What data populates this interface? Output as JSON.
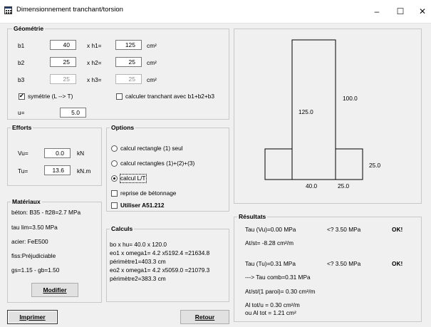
{
  "window": {
    "title": "Dimensionnement tranchant/torsion",
    "controls": [
      "–",
      "☐",
      "✕"
    ]
  },
  "geometrie": {
    "legend": "Géométrie",
    "b1_label": "b1",
    "b1_value": "40",
    "xh1_label": "x h1=",
    "h1_value": "125",
    "unit_h1": "cm²",
    "b2_label": "b2",
    "b2_value": "25",
    "xh2_label": "x h2=",
    "h2_value": "25",
    "unit_h2": "cm²",
    "b3_label": "b3",
    "b3_value": "25",
    "xh3_label": "x h3=",
    "h3_value": "25",
    "unit_h3": "cm²",
    "symetrie_label": "symétrie (L --> T)",
    "symetrie_checked": true,
    "calc_tranchant_label": "calculer tranchant avec b1+b2+b3",
    "calc_tranchant_checked": false,
    "u_label": "u=",
    "u_value": "5.0"
  },
  "efforts": {
    "legend": "Efforts",
    "vu_label": "Vu=",
    "vu_value": "0.0",
    "vu_unit": "kN",
    "tu_label": "Tu=",
    "tu_value": "13.6",
    "tu_unit": "kN.m"
  },
  "options": {
    "legend": "Options",
    "radios": [
      {
        "label": "calcul rectangle (1) seul",
        "checked": false
      },
      {
        "label": "calcul rectangles (1)+(2)+(3)",
        "checked": false
      },
      {
        "label": "calcul L/T",
        "checked": true
      }
    ],
    "reprise_label": "reprise de bétonnage",
    "reprise_checked": false,
    "a51_label": "Utiliser A51.212",
    "a51_checked": false
  },
  "materiaux": {
    "legend": "Matériaux",
    "lines": [
      "béton: B35 - ft28=2.7  MPa",
      "tau lim=3.50 MPa",
      "acier: FeE500",
      "fiss:Préjudiciable",
      "gs=1.15 - gb=1.50"
    ],
    "modifier_label": "Modifier"
  },
  "calculs": {
    "legend": "Calculs",
    "lines": [
      "bo x hu= 40.0 x 120.0",
      "eo1 x omega1= 4.2 x5192.4 =21634.8",
      "périmètre1=403.3 cm",
      "eo2 x omega1= 4.2 x5059.0 =21079.3",
      "périmètre2=383.3 cm"
    ]
  },
  "diagram": {
    "label_100": "100.0",
    "label_125": "125.0",
    "label_25_right": "25.0",
    "label_40": "40.0",
    "label_25_bottom": "25.0"
  },
  "resultats": {
    "legend": "Résultats",
    "tau_vu": "Tau (Vu)=0.00 MPa",
    "tau_vu_cmp": "<? 3.50 MPa",
    "tau_vu_ok": "OK!",
    "at_st": "At/st= -8.28  cm²/m",
    "tau_tu": "Tau (Tu)=0.31 MPa",
    "tau_tu_cmp": "<? 3.50 MPa",
    "tau_tu_ok": "OK!",
    "tau_comb": "---> Tau comb=0.31 MPa",
    "at_st_paroi": "At/st/(1 paroi)= 0.30  cm²/m",
    "al_tot_u": "Al tot/u     = 0.30  cm²/m",
    "al_tot": "ou Al tot     = 1.21  cm²"
  },
  "buttons": {
    "imprimer": "Imprimer",
    "retour": "Retour"
  }
}
